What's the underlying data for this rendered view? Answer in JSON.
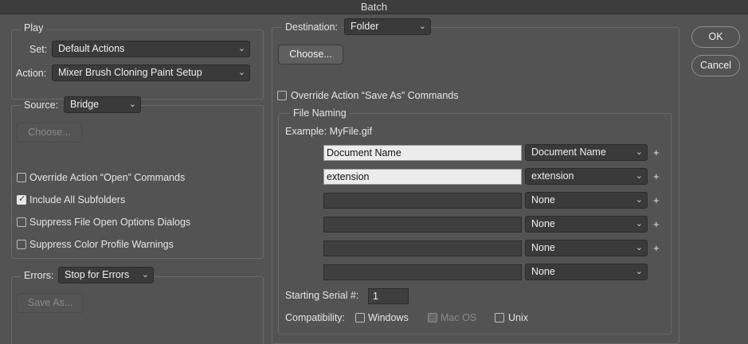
{
  "window": {
    "title": "Batch"
  },
  "play": {
    "legend": "Play",
    "set_label": "Set:",
    "set_value": "Default Actions",
    "action_label": "Action:",
    "action_value": "Mixer Brush Cloning Paint Setup"
  },
  "source": {
    "label": "Source:",
    "value": "Bridge",
    "choose_label": "Choose...",
    "options": [
      {
        "label": "Override Action “Open” Commands",
        "checked": false
      },
      {
        "label": "Include All Subfolders",
        "checked": true
      },
      {
        "label": "Suppress File Open Options Dialogs",
        "checked": false
      },
      {
        "label": "Suppress Color Profile Warnings",
        "checked": false
      }
    ]
  },
  "errors": {
    "label": "Errors:",
    "value": "Stop for Errors",
    "save_as_label": "Save As..."
  },
  "destination": {
    "label": "Destination:",
    "value": "Folder",
    "choose_label": "Choose...",
    "override_label": "Override Action “Save As” Commands",
    "override_checked": false
  },
  "file_naming": {
    "legend": "File Naming",
    "example": "Example: MyFile.gif",
    "rows": [
      {
        "text": "Document Name",
        "select": "Document Name",
        "plus": "+"
      },
      {
        "text": "extension",
        "select": "extension",
        "plus": "+"
      },
      {
        "text": "",
        "select": "None",
        "plus": "+"
      },
      {
        "text": "",
        "select": "None",
        "plus": "+"
      },
      {
        "text": "",
        "select": "None",
        "plus": "+"
      },
      {
        "text": "",
        "select": "None",
        "plus": ""
      }
    ],
    "serial_label": "Starting Serial #:",
    "serial_value": "1",
    "compat_label": "Compatibility:",
    "compat": [
      {
        "label": "Windows",
        "checked": false,
        "disabled": false
      },
      {
        "label": "Mac OS",
        "checked": true,
        "disabled": true
      },
      {
        "label": "Unix",
        "checked": false,
        "disabled": false
      }
    ]
  },
  "buttons": {
    "ok": "OK",
    "cancel": "Cancel"
  },
  "icons": {
    "select_chevron": "chevron-down-icon",
    "checkbox_check": "check-icon"
  }
}
